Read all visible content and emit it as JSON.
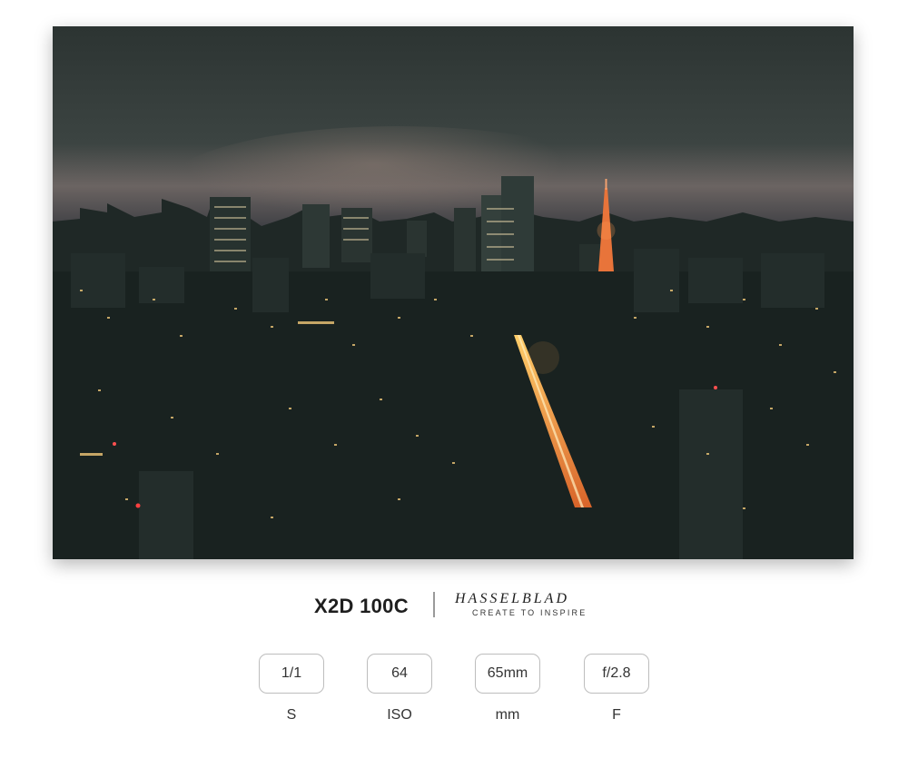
{
  "photo": {
    "subject": "night-city-skyline-photo"
  },
  "branding": {
    "model": "X2D 100C",
    "brand": "HASSELBLAD",
    "tagline": "CREATE TO INSPIRE"
  },
  "exif": [
    {
      "value": "1/1",
      "label": "S"
    },
    {
      "value": "64",
      "label": "ISO"
    },
    {
      "value": "65mm",
      "label": "mm"
    },
    {
      "value": "f/2.8",
      "label": "F"
    }
  ]
}
